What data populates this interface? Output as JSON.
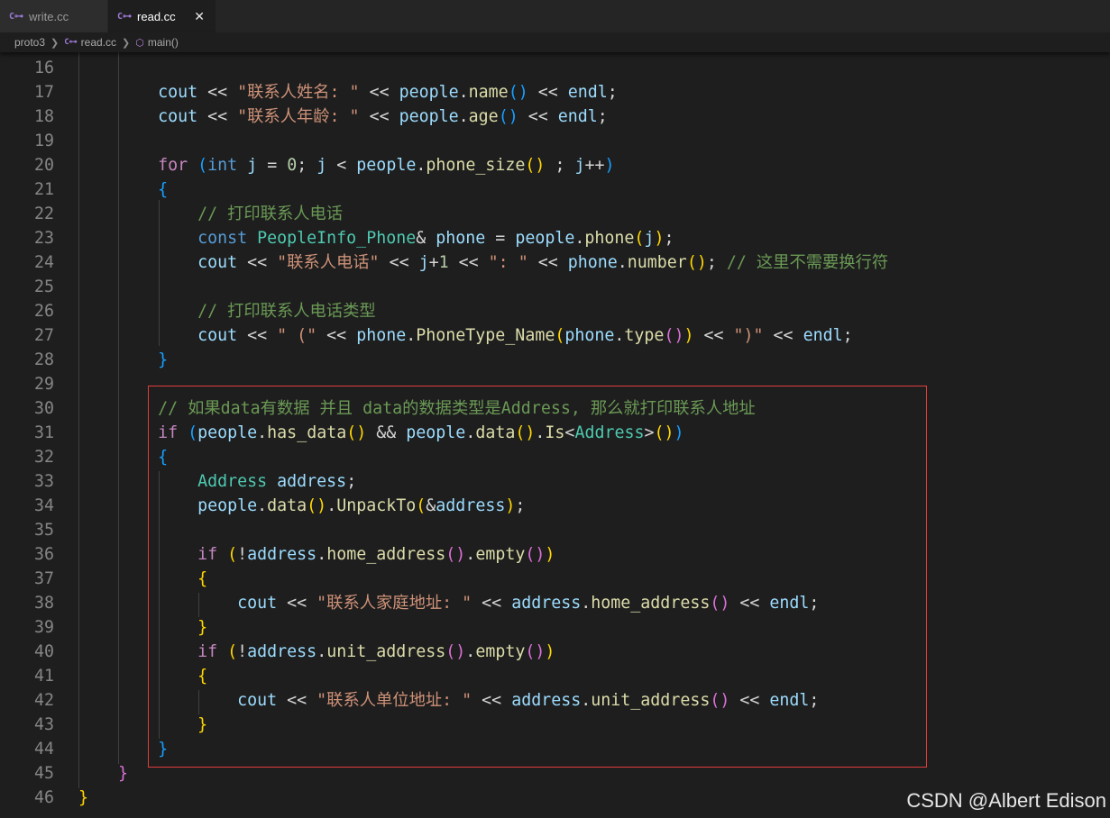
{
  "tabs": [
    {
      "label": "write.cc",
      "icon": "cpp-file-icon",
      "active": false
    },
    {
      "label": "read.cc",
      "icon": "cpp-file-icon",
      "active": true,
      "close": "✕"
    }
  ],
  "breadcrumb": {
    "folder": "proto3",
    "file": "read.cc",
    "symbol": "main()"
  },
  "editor": {
    "language": "C++",
    "lines": [
      {
        "n": "16",
        "tokens": []
      },
      {
        "n": "17",
        "tokens": [
          [
            "",
            "        "
          ],
          [
            "v",
            "cout"
          ],
          [
            "",
            " << "
          ],
          [
            "s",
            "\"联系人姓名: \""
          ],
          [
            "",
            " << "
          ],
          [
            "v",
            "people"
          ],
          [
            "",
            "."
          ],
          [
            "f",
            "name"
          ],
          [
            "b3",
            "()"
          ],
          [
            "",
            " << "
          ],
          [
            "v",
            "endl"
          ],
          [
            "",
            ";"
          ]
        ]
      },
      {
        "n": "18",
        "tokens": [
          [
            "",
            "        "
          ],
          [
            "v",
            "cout"
          ],
          [
            "",
            " << "
          ],
          [
            "s",
            "\"联系人年龄: \""
          ],
          [
            "",
            " << "
          ],
          [
            "v",
            "people"
          ],
          [
            "",
            "."
          ],
          [
            "f",
            "age"
          ],
          [
            "b3",
            "()"
          ],
          [
            "",
            " << "
          ],
          [
            "v",
            "endl"
          ],
          [
            "",
            ";"
          ]
        ]
      },
      {
        "n": "19",
        "tokens": []
      },
      {
        "n": "20",
        "tokens": [
          [
            "",
            "        "
          ],
          [
            "c",
            "for"
          ],
          [
            "",
            " "
          ],
          [
            "b3",
            "("
          ],
          [
            "k",
            "int"
          ],
          [
            "",
            " "
          ],
          [
            "v",
            "j"
          ],
          [
            "",
            " = "
          ],
          [
            "n",
            "0"
          ],
          [
            "",
            "; "
          ],
          [
            "v",
            "j"
          ],
          [
            "",
            " < "
          ],
          [
            "v",
            "people"
          ],
          [
            "",
            "."
          ],
          [
            "f",
            "phone_size"
          ],
          [
            "b1",
            "()"
          ],
          [
            "",
            " ; "
          ],
          [
            "v",
            "j"
          ],
          [
            "",
            "++"
          ],
          [
            "b3",
            ")"
          ]
        ]
      },
      {
        "n": "21",
        "tokens": [
          [
            "",
            "        "
          ],
          [
            "b3",
            "{"
          ]
        ]
      },
      {
        "n": "22",
        "tokens": [
          [
            "",
            "            "
          ],
          [
            "cm",
            "// 打印联系人电话"
          ]
        ]
      },
      {
        "n": "23",
        "tokens": [
          [
            "",
            "            "
          ],
          [
            "k",
            "const"
          ],
          [
            "",
            " "
          ],
          [
            "t",
            "PeopleInfo_Phone"
          ],
          [
            "",
            "& "
          ],
          [
            "v",
            "phone"
          ],
          [
            "",
            " = "
          ],
          [
            "v",
            "people"
          ],
          [
            "",
            "."
          ],
          [
            "f",
            "phone"
          ],
          [
            "b1",
            "("
          ],
          [
            "v",
            "j"
          ],
          [
            "b1",
            ")"
          ],
          [
            "",
            ";"
          ]
        ]
      },
      {
        "n": "24",
        "tokens": [
          [
            "",
            "            "
          ],
          [
            "v",
            "cout"
          ],
          [
            "",
            " << "
          ],
          [
            "s",
            "\"联系人电话\""
          ],
          [
            "",
            " << "
          ],
          [
            "v",
            "j"
          ],
          [
            "",
            "+"
          ],
          [
            "n",
            "1"
          ],
          [
            "",
            " << "
          ],
          [
            "s",
            "\": \""
          ],
          [
            "",
            " << "
          ],
          [
            "v",
            "phone"
          ],
          [
            "",
            "."
          ],
          [
            "f",
            "number"
          ],
          [
            "b1",
            "()"
          ],
          [
            "",
            "; "
          ],
          [
            "cm",
            "// 这里不需要换行符"
          ]
        ]
      },
      {
        "n": "25",
        "tokens": []
      },
      {
        "n": "26",
        "tokens": [
          [
            "",
            "            "
          ],
          [
            "cm",
            "// 打印联系人电话类型"
          ]
        ]
      },
      {
        "n": "27",
        "tokens": [
          [
            "",
            "            "
          ],
          [
            "v",
            "cout"
          ],
          [
            "",
            " << "
          ],
          [
            "s",
            "\" (\""
          ],
          [
            "",
            " << "
          ],
          [
            "v",
            "phone"
          ],
          [
            "",
            "."
          ],
          [
            "f",
            "PhoneType_Name"
          ],
          [
            "b1",
            "("
          ],
          [
            "v",
            "phone"
          ],
          [
            "",
            "."
          ],
          [
            "f",
            "type"
          ],
          [
            "b2",
            "()"
          ],
          [
            "b1",
            ")"
          ],
          [
            "",
            " << "
          ],
          [
            "s",
            "\")\""
          ],
          [
            "",
            " << "
          ],
          [
            "v",
            "endl"
          ],
          [
            "",
            ";"
          ]
        ]
      },
      {
        "n": "28",
        "tokens": [
          [
            "",
            "        "
          ],
          [
            "b3",
            "}"
          ]
        ]
      },
      {
        "n": "29",
        "tokens": []
      },
      {
        "n": "30",
        "tokens": [
          [
            "",
            "        "
          ],
          [
            "cm",
            "// 如果data有数据 并且 data的数据类型是Address, 那么就打印联系人地址"
          ]
        ]
      },
      {
        "n": "31",
        "tokens": [
          [
            "",
            "        "
          ],
          [
            "c",
            "if"
          ],
          [
            "",
            " "
          ],
          [
            "b3",
            "("
          ],
          [
            "v",
            "people"
          ],
          [
            "",
            "."
          ],
          [
            "f",
            "has_data"
          ],
          [
            "b1",
            "()"
          ],
          [
            "",
            " && "
          ],
          [
            "v",
            "people"
          ],
          [
            "",
            "."
          ],
          [
            "f",
            "data"
          ],
          [
            "b1",
            "()"
          ],
          [
            "",
            "."
          ],
          [
            "f",
            "Is"
          ],
          [
            "",
            "<"
          ],
          [
            "t",
            "Address"
          ],
          [
            "",
            ">"
          ],
          [
            "b1",
            "()"
          ],
          [
            "b3",
            ")"
          ]
        ]
      },
      {
        "n": "32",
        "tokens": [
          [
            "",
            "        "
          ],
          [
            "b3",
            "{"
          ]
        ]
      },
      {
        "n": "33",
        "tokens": [
          [
            "",
            "            "
          ],
          [
            "t",
            "Address"
          ],
          [
            "",
            " "
          ],
          [
            "v",
            "address"
          ],
          [
            "",
            ";"
          ]
        ]
      },
      {
        "n": "34",
        "tokens": [
          [
            "",
            "            "
          ],
          [
            "v",
            "people"
          ],
          [
            "",
            "."
          ],
          [
            "f",
            "data"
          ],
          [
            "b1",
            "()"
          ],
          [
            "",
            "."
          ],
          [
            "f",
            "UnpackTo"
          ],
          [
            "b1",
            "("
          ],
          [
            "",
            "&"
          ],
          [
            "v",
            "address"
          ],
          [
            "b1",
            ")"
          ],
          [
            "",
            ";"
          ]
        ]
      },
      {
        "n": "35",
        "tokens": []
      },
      {
        "n": "36",
        "tokens": [
          [
            "",
            "            "
          ],
          [
            "c",
            "if"
          ],
          [
            "",
            " "
          ],
          [
            "b1",
            "("
          ],
          [
            "",
            "!"
          ],
          [
            "v",
            "address"
          ],
          [
            "",
            "."
          ],
          [
            "f",
            "home_address"
          ],
          [
            "b2",
            "()"
          ],
          [
            "",
            "."
          ],
          [
            "f",
            "empty"
          ],
          [
            "b2",
            "()"
          ],
          [
            "b1",
            ")"
          ]
        ]
      },
      {
        "n": "37",
        "tokens": [
          [
            "",
            "            "
          ],
          [
            "b1",
            "{"
          ]
        ]
      },
      {
        "n": "38",
        "tokens": [
          [
            "",
            "                "
          ],
          [
            "v",
            "cout"
          ],
          [
            "",
            " << "
          ],
          [
            "s",
            "\"联系人家庭地址: \""
          ],
          [
            "",
            " << "
          ],
          [
            "v",
            "address"
          ],
          [
            "",
            "."
          ],
          [
            "f",
            "home_address"
          ],
          [
            "b2",
            "()"
          ],
          [
            "",
            " << "
          ],
          [
            "v",
            "endl"
          ],
          [
            "",
            ";"
          ]
        ]
      },
      {
        "n": "39",
        "tokens": [
          [
            "",
            "            "
          ],
          [
            "b1",
            "}"
          ]
        ]
      },
      {
        "n": "40",
        "tokens": [
          [
            "",
            "            "
          ],
          [
            "c",
            "if"
          ],
          [
            "",
            " "
          ],
          [
            "b1",
            "("
          ],
          [
            "",
            "!"
          ],
          [
            "v",
            "address"
          ],
          [
            "",
            "."
          ],
          [
            "f",
            "unit_address"
          ],
          [
            "b2",
            "()"
          ],
          [
            "",
            "."
          ],
          [
            "f",
            "empty"
          ],
          [
            "b2",
            "()"
          ],
          [
            "b1",
            ")"
          ]
        ]
      },
      {
        "n": "41",
        "tokens": [
          [
            "",
            "            "
          ],
          [
            "b1",
            "{"
          ]
        ]
      },
      {
        "n": "42",
        "tokens": [
          [
            "",
            "                "
          ],
          [
            "v",
            "cout"
          ],
          [
            "",
            " << "
          ],
          [
            "s",
            "\"联系人单位地址: \""
          ],
          [
            "",
            " << "
          ],
          [
            "v",
            "address"
          ],
          [
            "",
            "."
          ],
          [
            "f",
            "unit_address"
          ],
          [
            "b2",
            "()"
          ],
          [
            "",
            " << "
          ],
          [
            "v",
            "endl"
          ],
          [
            "",
            ";"
          ]
        ]
      },
      {
        "n": "43",
        "tokens": [
          [
            "",
            "            "
          ],
          [
            "b1",
            "}"
          ]
        ]
      },
      {
        "n": "44",
        "tokens": [
          [
            "",
            "        "
          ],
          [
            "b3",
            "}"
          ]
        ]
      },
      {
        "n": "45",
        "tokens": [
          [
            "",
            "    "
          ],
          [
            "b2",
            "}"
          ]
        ]
      },
      {
        "n": "46",
        "tokens": [
          [
            "b1",
            "}"
          ]
        ]
      }
    ]
  },
  "highlight": {
    "color": "#e23c3c",
    "first_line": "30",
    "last_line": "44"
  },
  "watermark": "CSDN @Albert Edison",
  "colors": {
    "background": "#1e1e1e",
    "keyword": "#569cd6",
    "control": "#c586c0",
    "variable": "#9cdcfe",
    "function": "#dcdcaa",
    "string": "#ce9178",
    "type": "#4ec9b0",
    "number": "#b5cea8",
    "comment": "#6a9955"
  }
}
